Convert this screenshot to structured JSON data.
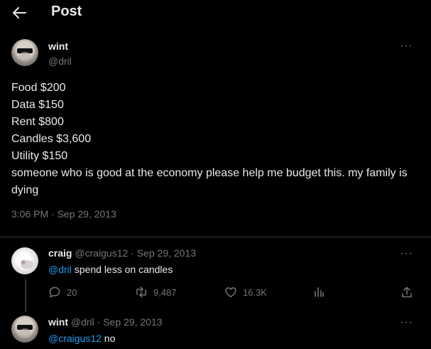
{
  "header": {
    "title": "Post",
    "back_icon": "arrow-left-icon"
  },
  "main_post": {
    "author_name": "wint",
    "author_handle": "@dril",
    "more_icon": "more-dots-icon",
    "lines": [
      "Food $200",
      "Data $150",
      "Rent $800",
      "Candles $3,600",
      "Utility $150"
    ],
    "text": "someone who is good at the economy please help me budget this. my family is dying",
    "timestamp": "3:06 PM · Sep 29, 2013"
  },
  "reply1": {
    "name": "craig",
    "handle": "@craigus12",
    "date": "· Sep 29, 2013",
    "mention": "@dril",
    "text": " spend less on candles",
    "stats": {
      "replies": "20",
      "reposts": "9,487",
      "likes": "16.3K"
    }
  },
  "reply2": {
    "name": "wint",
    "handle": "@dril",
    "date": "· Sep 29, 2013",
    "mention": "@craigus12",
    "text": " no"
  },
  "colors": {
    "background": "#000000",
    "text": "#e7e9ea",
    "muted": "#71767b",
    "link": "#1d9bf0",
    "border": "#2f3336"
  }
}
